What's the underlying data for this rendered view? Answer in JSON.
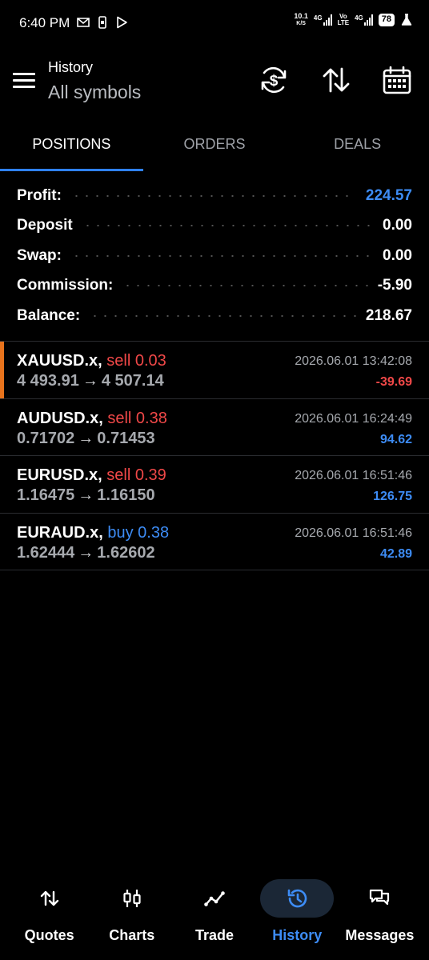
{
  "status_bar": {
    "time": "6:40 PM",
    "net_speed_value": "10.1",
    "net_speed_unit": "K/S",
    "sim1": "4G",
    "volte": "Vo\nLTE",
    "sim2": "4G",
    "battery": "78"
  },
  "header": {
    "title": "History",
    "subtitle": "All symbols",
    "icons": [
      "currency-sync-icon",
      "sort-icon",
      "calendar-icon"
    ]
  },
  "tabs": [
    {
      "label": "POSITIONS",
      "active": true
    },
    {
      "label": "ORDERS",
      "active": false
    },
    {
      "label": "DEALS",
      "active": false
    }
  ],
  "summary": [
    {
      "label": "Profit:",
      "value": "224.57",
      "color": "#3d8cf5"
    },
    {
      "label": "Deposit",
      "value": "0.00"
    },
    {
      "label": "Swap:",
      "value": "0.00"
    },
    {
      "label": "Commission:",
      "value": "-5.90"
    },
    {
      "label": "Balance:",
      "value": "218.67"
    }
  ],
  "positions": [
    {
      "symbol": "XAUUSD.x,",
      "side": "sell 0.03",
      "open": "4 493.91",
      "arrow": "→",
      "close": "4 507.14",
      "time": "2026.06.01 13:42:08",
      "profit": "-39.69"
    },
    {
      "symbol": "AUDUSD.x,",
      "side": "sell 0.38",
      "open": "0.71702",
      "arrow": "→",
      "close": "0.71453",
      "time": "2026.06.01 16:24:49",
      "profit": "94.62"
    },
    {
      "symbol": "EURUSD.x,",
      "side": "sell 0.39",
      "open": "1.16475",
      "arrow": "→",
      "close": "1.16150",
      "time": "2026.06.01 16:51:46",
      "profit": "126.75"
    },
    {
      "symbol": "EURAUD.x,",
      "side": "buy 0.38",
      "open": "1.62444",
      "arrow": "→",
      "close": "1.62602",
      "time": "2026.06.01 16:51:46",
      "profit": "42.89"
    }
  ],
  "colors": {
    "accent": "#3d8cf5",
    "loss": "#f04848",
    "highlight_marker": "#e8731c"
  },
  "bottom_nav": [
    {
      "label": "Quotes",
      "icon": "quotes-arrows-icon",
      "active": false
    },
    {
      "label": "Charts",
      "icon": "candlestick-icon",
      "active": false
    },
    {
      "label": "Trade",
      "icon": "trade-line-icon",
      "active": false
    },
    {
      "label": "History",
      "icon": "history-clock-icon",
      "active": true
    },
    {
      "label": "Messages",
      "icon": "messages-icon",
      "active": false
    }
  ]
}
